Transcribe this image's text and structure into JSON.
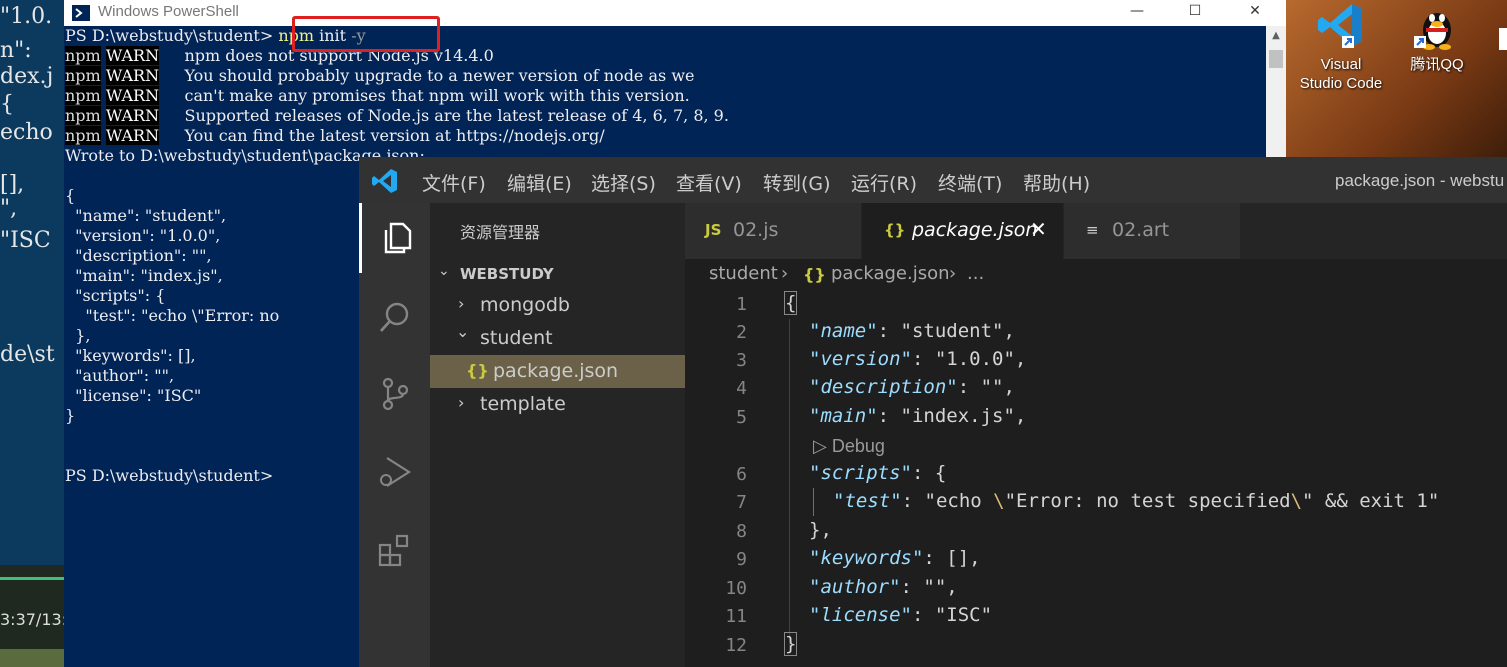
{
  "background_terminal": {
    "lines": [
      "\"1.0.",
      "n\":",
      "dex.j",
      "{",
      "echo",
      "[],",
      "\",",
      "\"ISC",
      "de\\st"
    ],
    "video_time": "3:37/13:"
  },
  "powershell": {
    "title": "Windows PowerShell",
    "prompt1": "PS D:\\webstudy\\student> ",
    "command_name": "npm",
    "command_args": " init ",
    "command_flag": "-y",
    "npm": "npm",
    "warn": "WARN",
    "warnings": [
      "npm does not support Node.js v14.4.0",
      "You should probably upgrade to a newer version of node as we",
      "can't make any promises that npm will work with this version.",
      "Supported releases of Node.js are the latest release of 4, 6, 7, 8, 9.",
      "You can find the latest version at https://nodejs.org/"
    ],
    "wrote": "Wrote to D:\\webstudy\\student\\package.json:",
    "json_lines": [
      "{",
      "  \"name\": \"student\",",
      "  \"version\": \"1.0.0\",",
      "  \"description\": \"\",",
      "  \"main\": \"index.js\",",
      "  \"scripts\": {",
      "    \"test\": \"echo \\\"Error: no",
      "  },",
      "  \"keywords\": [],",
      "  \"author\": \"\",",
      "  \"license\": \"ISC\"",
      "}"
    ],
    "prompt2": "PS D:\\webstudy\\student>"
  },
  "desktop": {
    "icons": [
      {
        "label_line1": "Visual",
        "label_line2": "Studio Code",
        "icon": "vscode-icon"
      },
      {
        "label_line1": "腾讯QQ",
        "label_line2": "",
        "icon": "qq-icon"
      }
    ]
  },
  "vscode": {
    "window_title": "package.json - webstu",
    "menu": [
      "文件(F)",
      "编辑(E)",
      "选择(S)",
      "查看(V)",
      "转到(G)",
      "运行(R)",
      "终端(T)",
      "帮助(H)"
    ],
    "explorer_title": "资源管理器",
    "workspace": "WEBSTUDY",
    "tree": [
      {
        "label": "mongodb",
        "chevron": "›"
      },
      {
        "label": "student",
        "chevron": "⌄"
      },
      {
        "label": "package.json",
        "icon": "{}"
      },
      {
        "label": "template",
        "chevron": "›"
      }
    ],
    "tabs": [
      {
        "label": "02.js",
        "icon": "JS"
      },
      {
        "label": "package.json",
        "icon": "{}",
        "close": "✕"
      },
      {
        "label": "02.art",
        "icon": "≡"
      }
    ],
    "breadcrumb": {
      "folder": "student",
      "sep1": "›",
      "file_icon": "{}",
      "file": "package.json",
      "sep2": "›",
      "more": "..."
    },
    "codelens": "▷ Debug",
    "line_numbers": [
      "1",
      "2",
      "3",
      "4",
      "5",
      "6",
      "7",
      "8",
      "9",
      "10",
      "11",
      "12"
    ],
    "code": {
      "l1": "{",
      "name_key": "\"name\"",
      "name_val": ": \"student\",",
      "version_key": "\"version\"",
      "version_val": ": \"1.0.0\",",
      "description_key": "\"description\"",
      "description_val": ": \"\",",
      "main_key": "\"main\"",
      "main_val": ": \"index.js\",",
      "scripts_key": "\"scripts\"",
      "scripts_val": ": {",
      "test_key": "\"test\"",
      "test_val_a": ": \"echo ",
      "esc1": "\\",
      "test_val_b": "\"Error: no test specified",
      "esc2": "\\",
      "test_val_c": "\" && exit 1\"",
      "l8": "},",
      "keywords_key": "\"keywords\"",
      "keywords_val": ": [],",
      "author_key": "\"author\"",
      "author_val": ": \"\",",
      "license_key": "\"license\"",
      "license_val": ": \"ISC\"",
      "l12": "}"
    }
  }
}
